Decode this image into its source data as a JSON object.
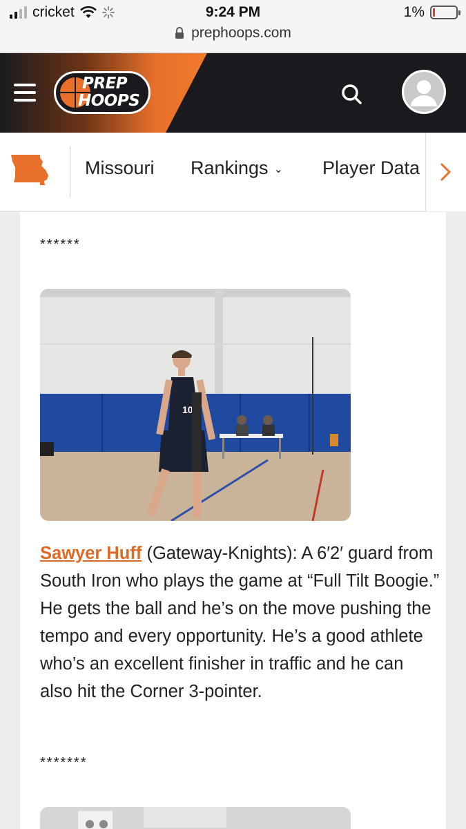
{
  "status_bar": {
    "carrier": "cricket",
    "time": "9:24 PM",
    "battery": "1%",
    "url": "prephoops.com"
  },
  "header": {
    "logo_line1": "PREP",
    "logo_line2": "HOOPS",
    "accent_color": "#e8702a"
  },
  "subnav": {
    "items": [
      {
        "label": "Missouri"
      },
      {
        "label": "Rankings"
      },
      {
        "label": "Player Data"
      }
    ]
  },
  "article": {
    "separator_top": "******",
    "separator_bottom": "*******",
    "player_name": "Sawyer Huff",
    "player_text": " (Gateway-Knights): A 6′2′ guard from South Iron who plays the game at “Full Tilt Boogie.” He gets the ball and he’s on the move pushing the tempo and every opportunity. He’s a good athlete who’s an excellent finisher in traffic and he can also hit the Corner 3-pointer."
  }
}
